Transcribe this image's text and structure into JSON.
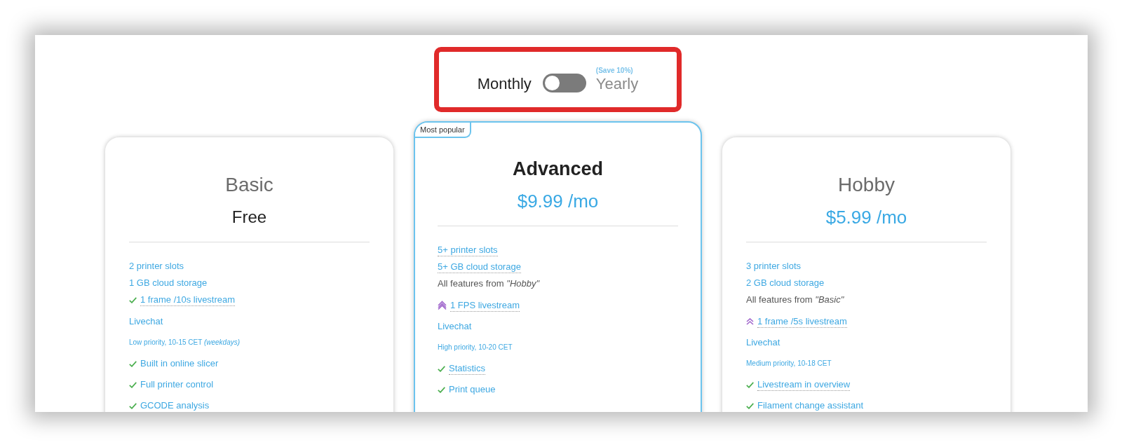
{
  "billing_toggle": {
    "highlighted": true,
    "monthly_label": "Monthly",
    "yearly_label": "Yearly",
    "yearly_note": "(Save 10%)",
    "on": false
  },
  "plans": [
    {
      "name": "Basic",
      "featured": false,
      "price": {
        "text": "Free",
        "kind": "free"
      },
      "limits": [
        {
          "text": "2 printer slots",
          "kind": "plain",
          "underlined": false
        },
        {
          "text": "1 GB cloud storage",
          "kind": "plain",
          "underlined": false
        },
        {
          "text": "1 frame /10s livestream",
          "kind": "check",
          "underlined": true
        }
      ],
      "features": [
        {
          "text": "Livechat",
          "kind": "plain",
          "underlined": false
        },
        {
          "text": "Low priority, 10-15 CET *(weekdays)*",
          "kind": "note",
          "underlined": false
        },
        {
          "text": "Built in online slicer",
          "kind": "check",
          "underlined": false
        },
        {
          "text": "Full printer control",
          "kind": "check",
          "underlined": false
        },
        {
          "text": "GCODE analysis",
          "kind": "check",
          "underlined": false
        }
      ]
    },
    {
      "name": "Advanced",
      "featured": true,
      "badge": "Most popular",
      "price": {
        "text": "$9.99 /mo",
        "kind": "paid"
      },
      "limits": [
        {
          "text": "5+ printer slots",
          "kind": "plain",
          "underlined": true
        },
        {
          "text": "5+ GB cloud storage",
          "kind": "plain",
          "underlined": true
        },
        {
          "text": "All features from *\"Hobby\"*",
          "kind": "inherit",
          "underlined": false
        }
      ],
      "features": [
        {
          "text": "1 FPS livestream",
          "kind": "upgrade",
          "underlined": true
        },
        {
          "text": "Livechat",
          "kind": "plain",
          "underlined": false
        },
        {
          "text": "High priority, 10-20 CET",
          "kind": "note",
          "underlined": false
        },
        {
          "text": "Statistics",
          "kind": "check",
          "underlined": true
        },
        {
          "text": "Print queue",
          "kind": "check",
          "underlined": false
        }
      ]
    },
    {
      "name": "Hobby",
      "featured": false,
      "price": {
        "text": "$5.99 /mo",
        "kind": "paid"
      },
      "limits": [
        {
          "text": "3 printer slots",
          "kind": "plain",
          "underlined": false
        },
        {
          "text": "2 GB cloud storage",
          "kind": "plain",
          "underlined": false
        },
        {
          "text": "All features from *\"Basic\"*",
          "kind": "inherit",
          "underlined": false
        }
      ],
      "features": [
        {
          "text": "1 frame /5s livestream",
          "kind": "upgrade",
          "underlined": true
        },
        {
          "text": "Livechat",
          "kind": "plain",
          "underlined": false
        },
        {
          "text": "Medium priority, 10-18 CET",
          "kind": "note",
          "underlined": false
        },
        {
          "text": "Livestream in overview",
          "kind": "check",
          "underlined": true
        },
        {
          "text": "Filament change assistant",
          "kind": "check",
          "underlined": false
        }
      ]
    }
  ]
}
